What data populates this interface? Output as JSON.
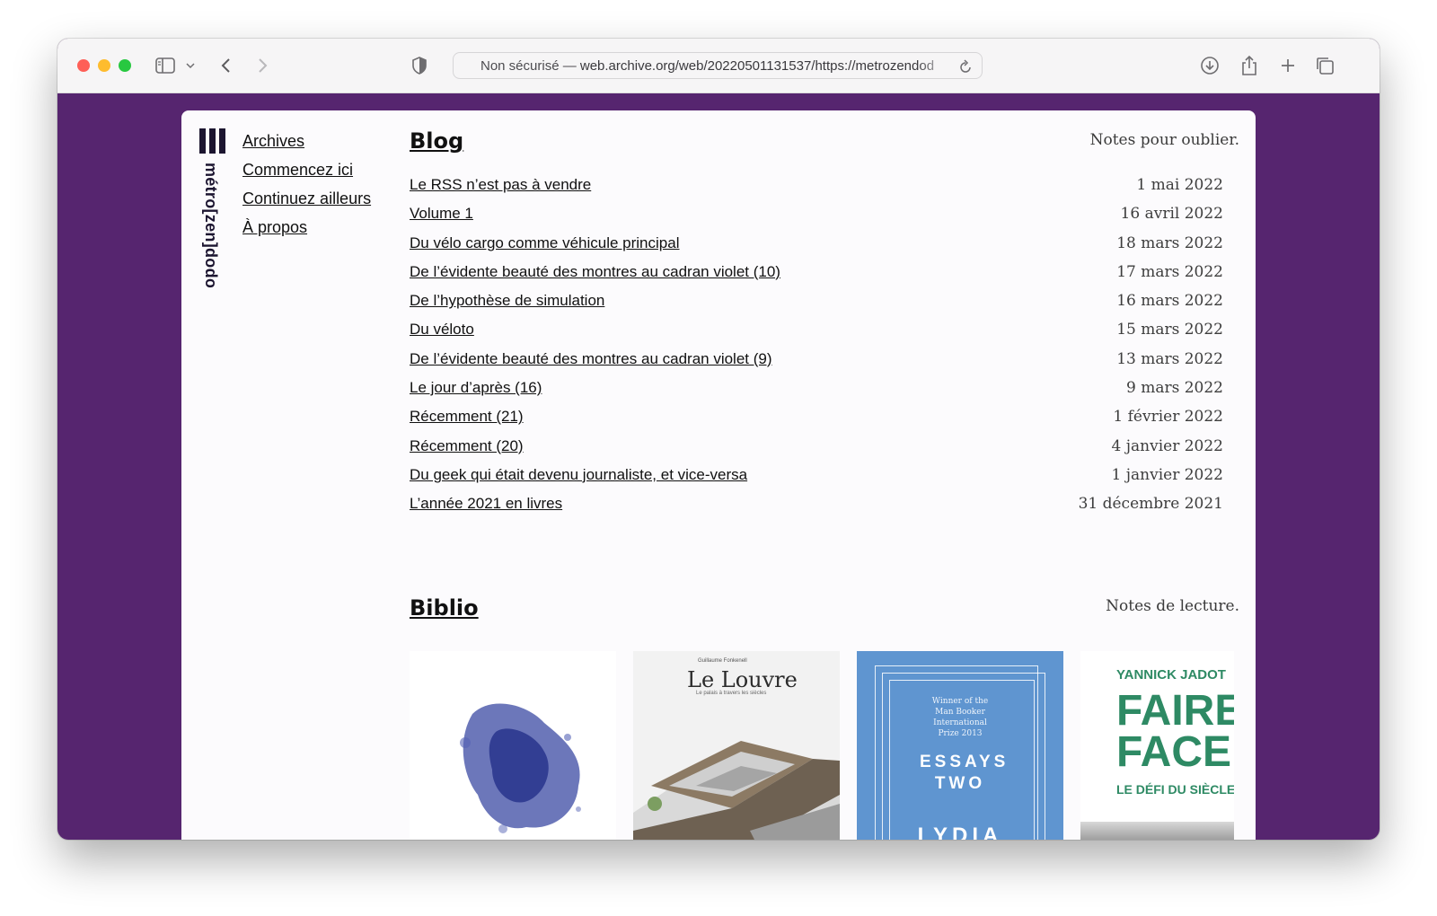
{
  "browser": {
    "address_prefix": "Non sécurisé — ",
    "address_url": "web.archive.org/web/20220501131537/https://metrozendod"
  },
  "site": {
    "logo_text": "métro[zen]dodo",
    "nav": [
      "Archives",
      "Commencez ici",
      "Continuez ailleurs",
      "À propos"
    ]
  },
  "blog": {
    "title": "Blog",
    "tagline": "Notes pour oublier.",
    "posts": [
      {
        "title": "Le RSS n’est pas à vendre",
        "date": "1 mai 2022"
      },
      {
        "title": "Volume 1",
        "date": "16 avril 2022"
      },
      {
        "title": "Du vélo cargo comme véhicule principal",
        "date": "18 mars 2022"
      },
      {
        "title": "De l’évidente beauté des montres au cadran violet (10)",
        "date": "17 mars 2022"
      },
      {
        "title": "De l’hypothèse de simulation",
        "date": "16 mars 2022"
      },
      {
        "title": "Du véloto",
        "date": "15 mars 2022"
      },
      {
        "title": "De l’évidente beauté des montres au cadran violet (9)",
        "date": "13 mars 2022"
      },
      {
        "title": "Le jour d’après (16)",
        "date": "9 mars 2022"
      },
      {
        "title": "Récemment (21)",
        "date": "1 février 2022"
      },
      {
        "title": "Récemment (20)",
        "date": "4 janvier 2022"
      },
      {
        "title": "Du geek qui était devenu journaliste, et vice-versa",
        "date": "1 janvier 2022"
      },
      {
        "title": "L’année 2021 en livres",
        "date": "31 décembre 2021"
      }
    ]
  },
  "biblio": {
    "title": "Biblio",
    "tagline": "Notes de lecture.",
    "books": [
      {
        "cover": "ink-blot"
      },
      {
        "cover_author": "Guillaume Fonkenell",
        "cover_title": "Le Louvre",
        "cover_subtitle": "Le palais à travers les siècles"
      },
      {
        "cover_note": "Winner of the Man Booker International Prize 2013",
        "cover_title": "ESSAYS TWO",
        "cover_author": "LYDIA"
      },
      {
        "cover_author": "YANNICK JADOT",
        "cover_title": "FAIRE FACE",
        "cover_subtitle": "LE DÉFI DU SIÈCLE"
      }
    ]
  },
  "colors": {
    "background": "#56256f",
    "page": "#fcfbfd",
    "essays_cover": "#5f95d0",
    "jadot_green": "#2e8a64"
  }
}
